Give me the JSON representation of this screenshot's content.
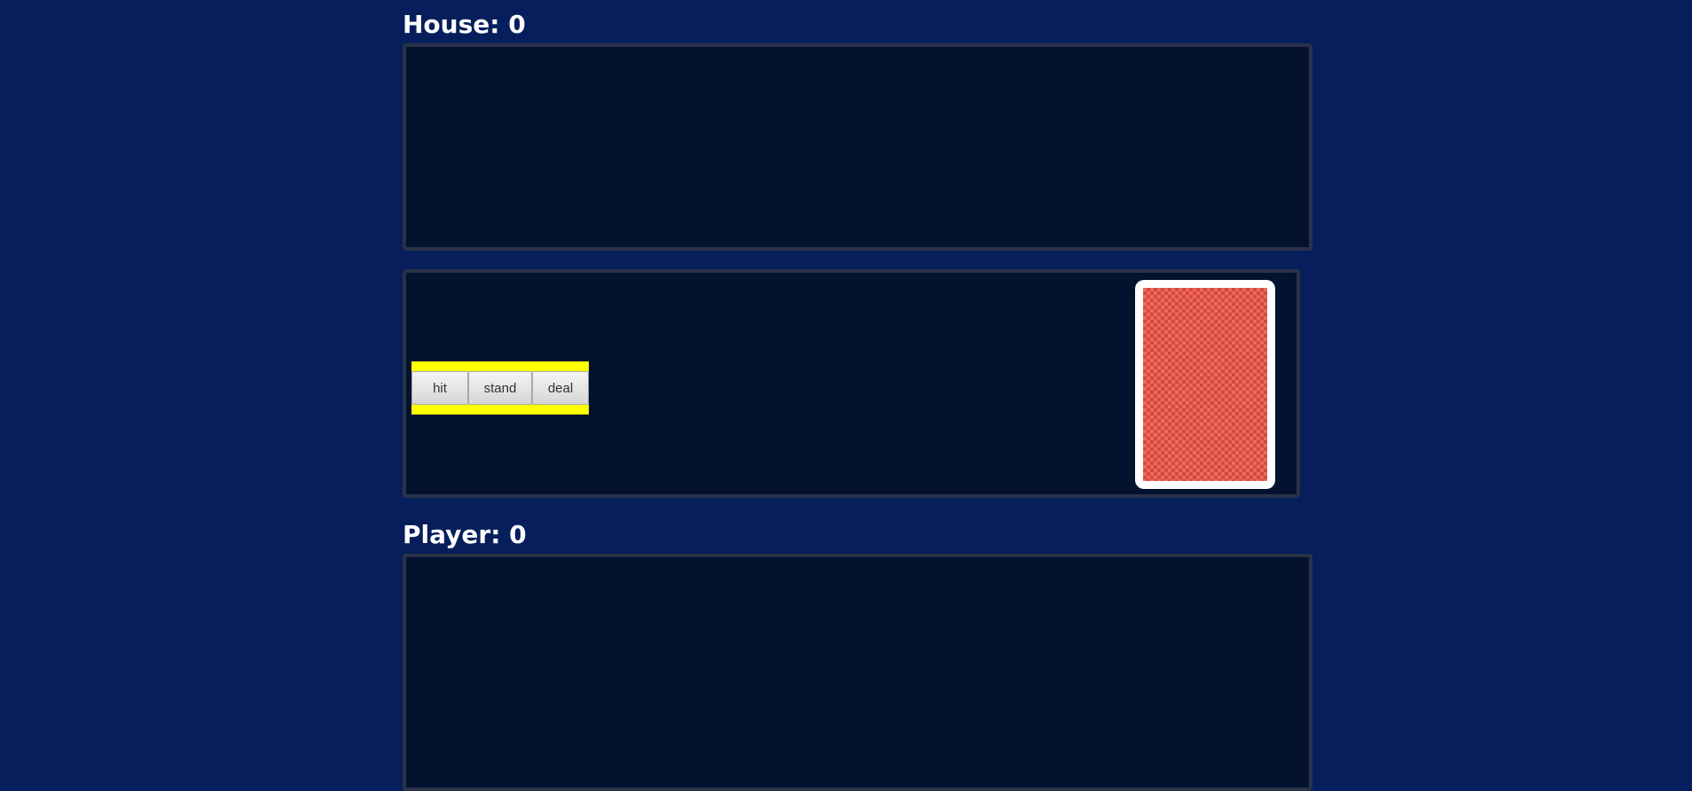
{
  "house": {
    "label": "House: 0",
    "score": 0
  },
  "player": {
    "label": "Player: 0",
    "score": 0
  },
  "controls": {
    "hit_label": "hit",
    "stand_label": "stand",
    "deal_label": "deal"
  },
  "deck": {
    "card_back_color": "#ec6a5e",
    "card_back_pattern_color": "#d9493d"
  },
  "colors": {
    "background": "#061f5c",
    "panel": "#02122f",
    "panel_border": "#2a3247",
    "controls_highlight": "#ffff00"
  }
}
